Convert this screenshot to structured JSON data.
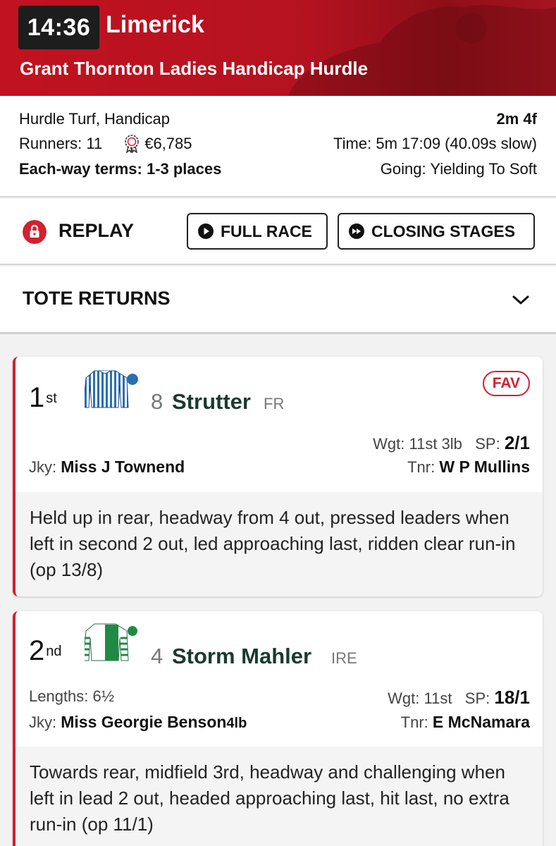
{
  "header": {
    "time": "14:36",
    "course": "Limerick",
    "race_name": "Grant Thornton Ladies Handicap Hurdle"
  },
  "info": {
    "race_type": "Hurdle Turf, Handicap",
    "distance": "2m 4f",
    "runners": "Runners: 11",
    "prize": "€6,785",
    "time": "Time: 5m 17:09 (40.09s slow)",
    "each_way": "Each-way terms: 1-3 places",
    "going": "Going: Yielding To Soft"
  },
  "replay": {
    "label": "REPLAY",
    "full_race": "FULL RACE",
    "closing_stages": "CLOSING STAGES"
  },
  "tote": {
    "label": "TOTE RETURNS"
  },
  "runners": [
    {
      "pos_num": "1",
      "pos_suffix": "st",
      "cloth": "8",
      "name": "Strutter",
      "country": "FR",
      "badge": "FAV",
      "wgt_label": "Wgt:",
      "wgt": "11st 3lb",
      "sp_label": "SP:",
      "sp": "2/1",
      "jky_label": "Jky:",
      "jockey": "Miss J Townend",
      "tnr_label": "Tnr:",
      "trainer": "W P Mullins",
      "comment": "Held up in rear, headway from 4 out, pressed leaders when left in second 2 out, led approaching last, ridden clear run-in (op 13/8)"
    },
    {
      "pos_num": "2",
      "pos_suffix": "nd",
      "cloth": "4",
      "name": "Storm Mahler",
      "country": "IRE",
      "lengths": "Lengths: 6½",
      "wgt_label": "Wgt:",
      "wgt": "11st",
      "sp_label": "SP:",
      "sp": "18/1",
      "jky_label": "Jky:",
      "jockey": "Miss Georgie Benson",
      "claim": "4lb",
      "tnr_label": "Tnr:",
      "trainer": "E McNamara",
      "comment": "Towards rear, midfield 3rd, headway and challenging when left in lead 2 out, headed approaching last, hit last, no extra run-in (op 11/1)"
    }
  ],
  "colors": {
    "brand_red": "#c1121f",
    "horse_name": "#1a3a30"
  },
  "icons": [
    "lock-icon",
    "prize-rosette-icon",
    "play-icon",
    "fast-forward-icon",
    "chevron-down-icon",
    "jockey-silks-icon"
  ]
}
